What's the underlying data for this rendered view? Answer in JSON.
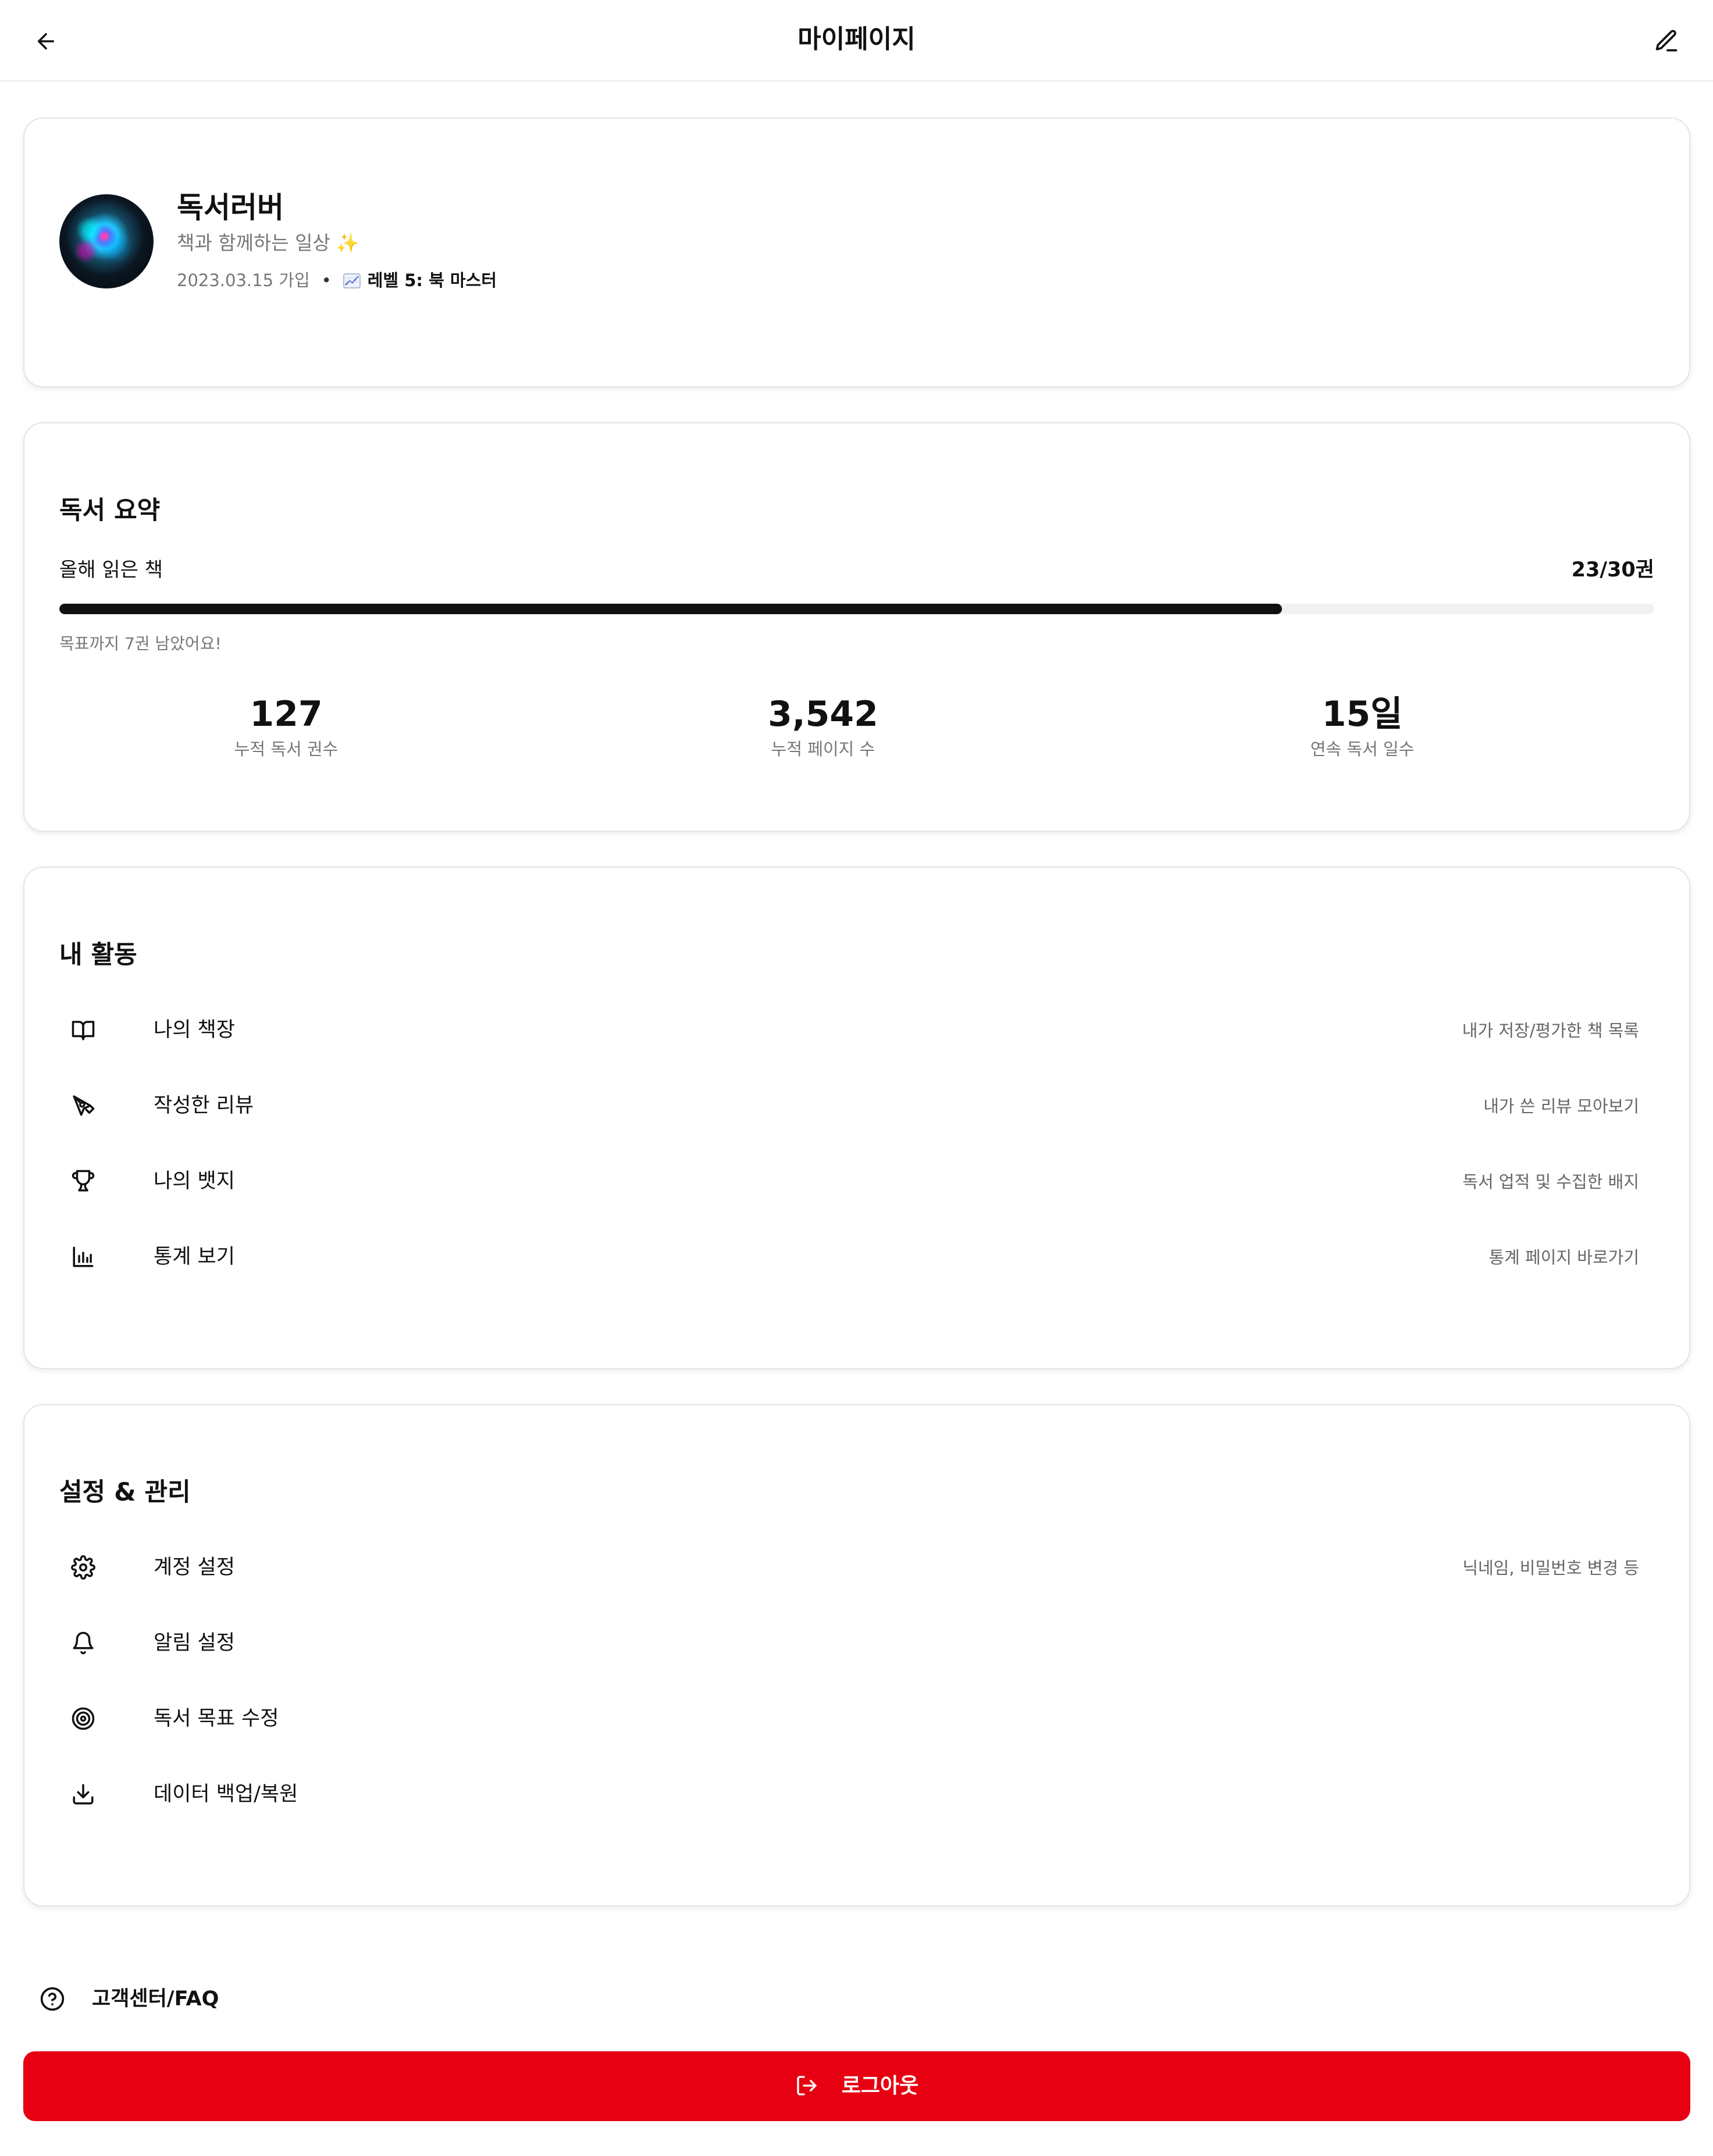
{
  "header": {
    "title": "마이페이지",
    "back_icon": "arrow-left-icon",
    "edit_icon": "pencil-icon"
  },
  "profile": {
    "name": "독서러버",
    "bio": "책과 함께하는 일상",
    "bio_emoji": "✨",
    "joined": "2023.03.15 가입",
    "separator": "•",
    "level_icon": "chart-increasing-icon",
    "level": "레벨 5: 북 마스터"
  },
  "summary": {
    "title": "독서 요약",
    "year_label": "올해 읽은 책",
    "year_value": "23/30권",
    "progress": 0.7667,
    "remain_text": "목표까지 7권 남았어요!",
    "stats": [
      {
        "value": "127",
        "label": "누적 독서 권수"
      },
      {
        "value": "3,542",
        "label": "누적 페이지 수"
      },
      {
        "value": "15일",
        "label": "연속 독서 일수"
      }
    ]
  },
  "activity": {
    "title": "내 활동",
    "items": [
      {
        "icon": "book-open-icon",
        "label": "나의 책장",
        "desc": "내가 저장/평가한 책 목록"
      },
      {
        "icon": "pen-tool-icon",
        "label": "작성한 리뷰",
        "desc": "내가 쓴 리뷰 모아보기"
      },
      {
        "icon": "trophy-icon",
        "label": "나의 뱃지",
        "desc": "독서 업적 및 수집한 배지"
      },
      {
        "icon": "bar-chart-icon",
        "label": "통계 보기",
        "desc": "통계 페이지 바로가기"
      }
    ]
  },
  "settings": {
    "title": "설정 & 관리",
    "items": [
      {
        "icon": "gear-icon",
        "label": "계정 설정",
        "desc": "닉네임, 비밀번호 변경 등"
      },
      {
        "icon": "bell-icon",
        "label": "알림 설정",
        "desc": ""
      },
      {
        "icon": "target-icon",
        "label": "독서 목표 수정",
        "desc": ""
      },
      {
        "icon": "download-icon",
        "label": "데이터 백업/복원",
        "desc": ""
      }
    ]
  },
  "support": {
    "icon": "help-circle-icon",
    "label": "고객센터/FAQ"
  },
  "logout": {
    "icon": "logout-icon",
    "label": "로그아웃",
    "color": "#e60012"
  }
}
